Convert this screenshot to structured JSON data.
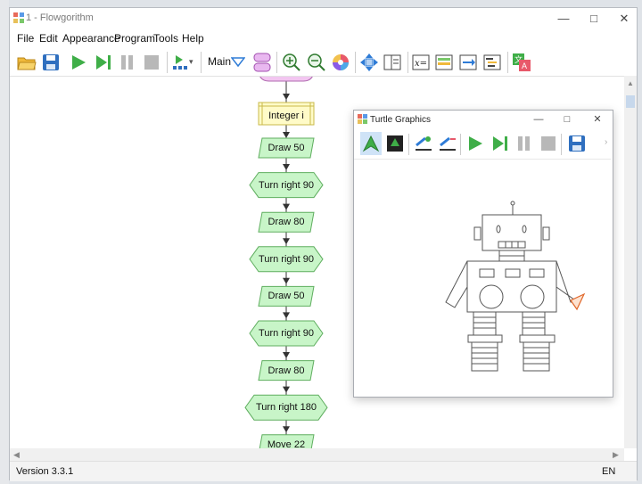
{
  "window": {
    "title": "1 - Flowgorithm",
    "controls": {
      "minimize": "—",
      "maximize": "□",
      "close": "✕"
    }
  },
  "menu": [
    "File",
    "Edit",
    "Appearance",
    "Program",
    "Tools",
    "Help"
  ],
  "toolbar": {
    "buttons": [
      "open-icon",
      "save-icon",
      "run-icon",
      "step-icon",
      "pause-icon",
      "stop-icon",
      "step-into-icon"
    ],
    "function_select": "Main",
    "view_buttons": [
      "layout-icon",
      "zoom-in-icon",
      "zoom-out-icon",
      "color-icon",
      "move-icon",
      "panels-icon",
      "variable-watch-icon",
      "console-icon",
      "output-icon",
      "code-icon",
      "translate-icon"
    ]
  },
  "flowchart": {
    "declare": "Integer i",
    "steps": [
      {
        "label": "Draw 50",
        "kind": "call"
      },
      {
        "label": "Turn right 90",
        "kind": "call"
      },
      {
        "label": "Draw 80",
        "kind": "call"
      },
      {
        "label": "Turn right 90",
        "kind": "call"
      },
      {
        "label": "Draw 50",
        "kind": "call"
      },
      {
        "label": "Turn right 90",
        "kind": "call"
      },
      {
        "label": "Draw 80",
        "kind": "call"
      },
      {
        "label": "Turn right 180",
        "kind": "call"
      },
      {
        "label": "Move 22",
        "kind": "call"
      }
    ]
  },
  "status": {
    "version": "Version 3.3.1",
    "language": "EN"
  },
  "turtle_window": {
    "title": "Turtle Graphics",
    "controls": {
      "minimize": "—",
      "maximize": "□",
      "close": "✕"
    },
    "toolbar": [
      "pen-up-icon",
      "pen-down-icon",
      "clear-icon",
      "reset-icon",
      "run-icon",
      "step-icon",
      "pause-icon",
      "stop-icon",
      "save-icon"
    ]
  },
  "colors": {
    "call_fill": "#c8f5c8",
    "call_stroke": "#5fae5f",
    "declare_fill": "#fffbc8",
    "declare_stroke": "#c9b94a",
    "start_fill": "#f2c5f0",
    "accent": "#2e7bd6"
  }
}
